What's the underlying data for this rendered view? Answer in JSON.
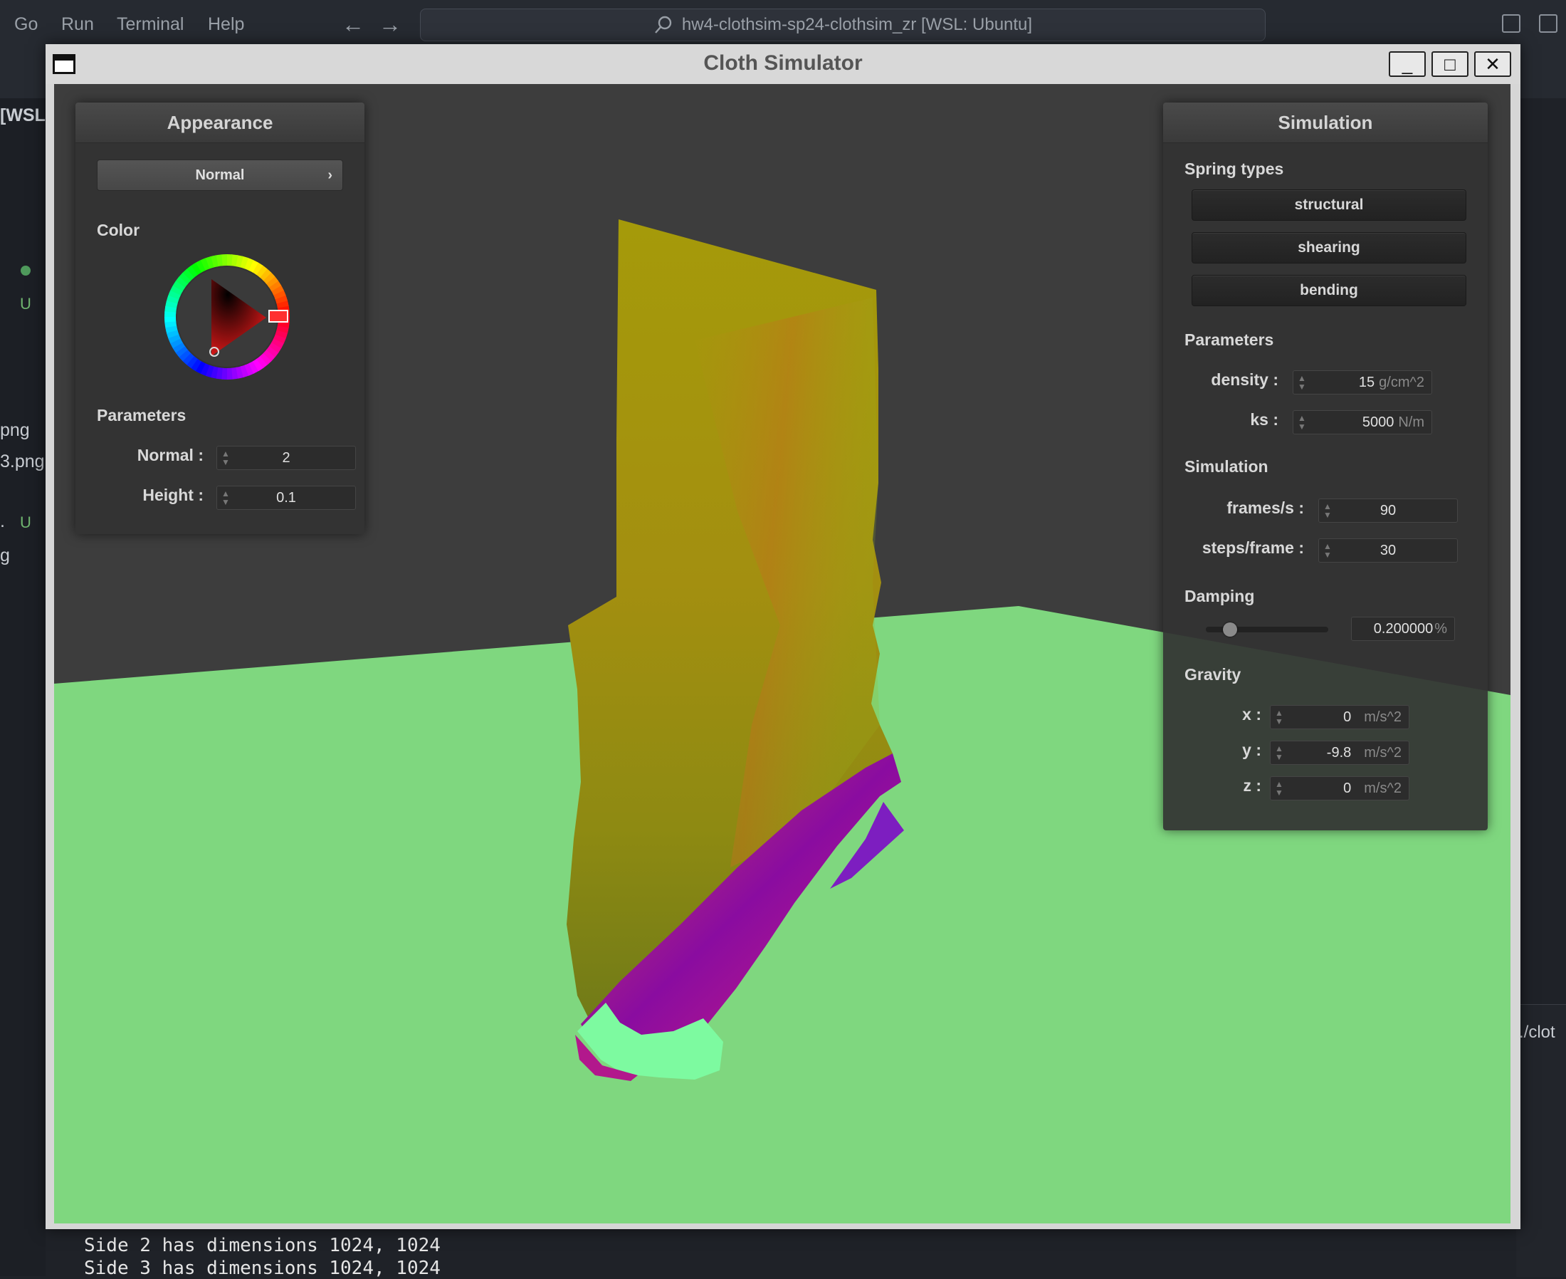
{
  "vscode": {
    "menu": [
      "Go",
      "Run",
      "Terminal",
      "Help"
    ],
    "command_center": "hw4-clothsim-sp24-clothsim_zr [WSL: Ubuntu]",
    "sidebar_header": "[WSL...",
    "sidebar_files": [
      "png",
      "3.png",
      "g"
    ],
    "sidebar_status": [
      "U",
      "U"
    ],
    "sidebar_dot_text": ".",
    "terminal_cmd": "./clot",
    "terminal_lines": [
      "Side 2 has dimensions 1024, 1024",
      "Side 3 has dimensions 1024, 1024"
    ]
  },
  "window": {
    "title": "Cloth Simulator",
    "minimize": "_",
    "maximize": "□",
    "close": "✕"
  },
  "appearance": {
    "title": "Appearance",
    "mode": "Normal",
    "mode_chevron": "›",
    "color_label": "Color",
    "params_label": "Parameters",
    "normal_label": "Normal :",
    "normal_value": "2",
    "height_label": "Height :",
    "height_value": "0.1",
    "cloth_color": "#ff0000"
  },
  "simulation": {
    "title": "Simulation",
    "spring_types_label": "Spring types",
    "springs": [
      "structural",
      "shearing",
      "bending"
    ],
    "params_label": "Parameters",
    "density_label": "density :",
    "density_value": "15",
    "density_unit": "g/cm^2",
    "ks_label": "ks :",
    "ks_value": "5000",
    "ks_unit": "N/m",
    "sim_label": "Simulation",
    "fps_label": "frames/s :",
    "fps_value": "90",
    "steps_label": "steps/frame :",
    "steps_value": "30",
    "damping_label": "Damping",
    "damping_value": "0.200000",
    "damping_unit": "%",
    "damping_fraction": 0.2,
    "gravity_label": "Gravity",
    "gx_label": "x :",
    "gx_value": "0",
    "gy_label": "y :",
    "gy_value": "-9.8",
    "gz_label": "z :",
    "gz_value": "0",
    "gravity_unit": "m/s^2"
  }
}
